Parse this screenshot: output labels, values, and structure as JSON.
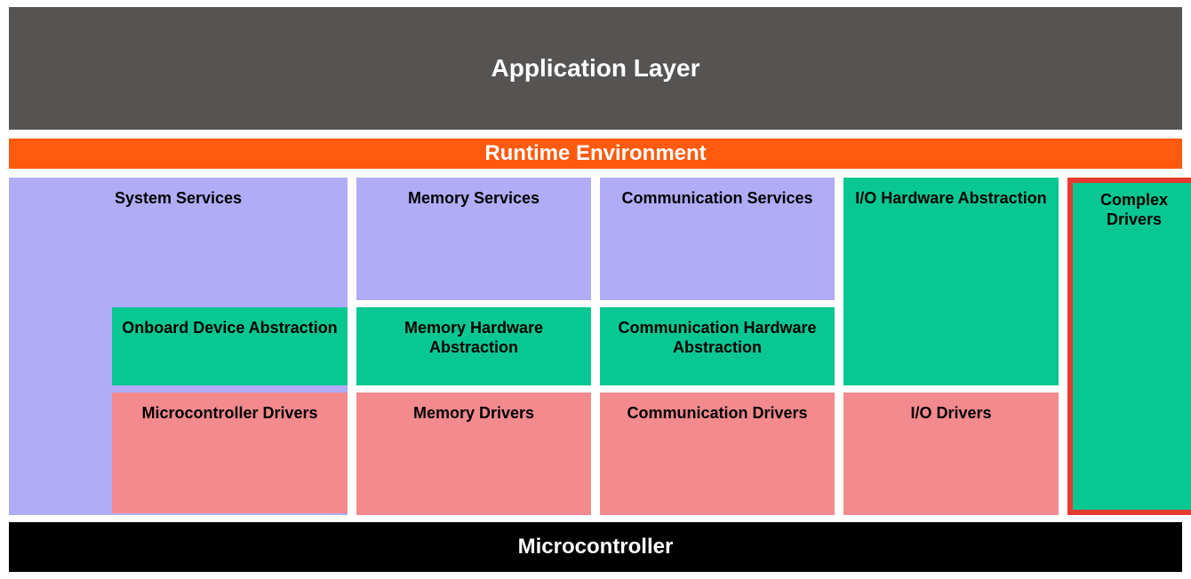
{
  "layers": {
    "application": "Application Layer",
    "runtime_env": "Runtime Environment",
    "microcontroller": "Microcontroller"
  },
  "services": {
    "system": "System Services",
    "memory": "Memory Services",
    "communication": "Communication Services",
    "io_hw_abstraction": "I/O Hardware Abstraction",
    "complex_drivers": "Complex Drivers"
  },
  "hw_abstraction": {
    "onboard_device": "Onboard Device Abstraction",
    "memory": "Memory Hardware Abstraction",
    "communication": "Communication Hardware Abstraction"
  },
  "drivers": {
    "microcontroller": "Microcontroller Drivers",
    "memory": "Memory Drivers",
    "communication": "Communication Drivers",
    "io": "I/O Drivers"
  },
  "colors": {
    "app_layer_bg": "#565353",
    "rte_bg": "#ff5a0e",
    "services_bg": "#b0acf6",
    "abstraction_bg": "#09c793",
    "drivers_bg": "#f38a8e",
    "highlight_border": "#e63a30",
    "mcu_bg": "#000000"
  }
}
